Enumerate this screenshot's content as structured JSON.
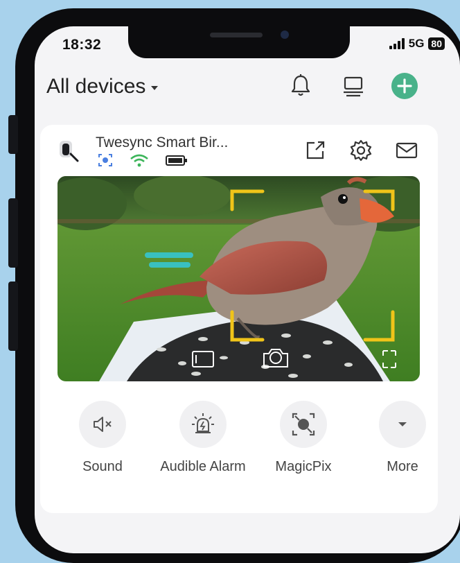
{
  "status_bar": {
    "time": "18:32",
    "network": "5G",
    "battery": "80"
  },
  "header": {
    "title": "All devices"
  },
  "device": {
    "name": "Twesync Smart Bir..."
  },
  "controls": [
    {
      "label": "Sound",
      "icon": "speaker-muted-icon"
    },
    {
      "label": "Audible Alarm",
      "icon": "alarm-siren-icon"
    },
    {
      "label": "MagicPix",
      "icon": "magicpix-icon"
    },
    {
      "label": "More",
      "icon": "caret-down-icon"
    }
  ],
  "colors": {
    "accent": "#49b28a",
    "focus_frame": "#f0c419",
    "background": "#a8d2ec"
  }
}
